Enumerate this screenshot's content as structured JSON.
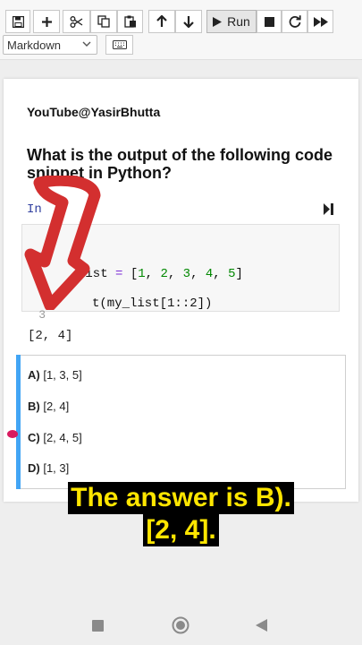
{
  "toolbar": {
    "buttons": [
      {
        "icon": "save-icon"
      },
      {
        "icon": "plus-icon"
      },
      {
        "icon": "scissors-icon"
      },
      {
        "icon": "copy-icon"
      },
      {
        "icon": "paste-icon"
      },
      {
        "icon": "arrow-up-icon"
      },
      {
        "icon": "arrow-down-icon"
      },
      {
        "icon": "play-icon"
      },
      {
        "icon": "stop-icon"
      },
      {
        "icon": "restart-icon"
      },
      {
        "icon": "fast-forward-icon"
      }
    ],
    "run_label": "Run",
    "cell_type": "Markdown",
    "keyboard_icon": "keyboard-icon"
  },
  "notebook": {
    "channel": "YouTube@YasirBhutta",
    "question": "What is the output of the following code snippet in Python?",
    "in_prompt": "In",
    "code_lines": [
      {
        "number": "1",
        "text_visible": "list = [1, 2, 3, 4, 5]"
      },
      {
        "number": "2",
        "text_visible": "t(my_list[1::2])"
      },
      {
        "number": "3",
        "text_visible": ""
      }
    ],
    "output": "[2, 4]",
    "options": [
      {
        "letter": "A)",
        "text": "[1, 3, 5]"
      },
      {
        "letter": "B)",
        "text": "[2, 4]"
      },
      {
        "letter": "C)",
        "text": "[2, 4, 5]"
      },
      {
        "letter": "D)",
        "text": "[1, 3]"
      }
    ]
  },
  "caption": {
    "line1": "The answer is B).",
    "line2": "[2, 4]."
  },
  "colors": {
    "caption_text": "#ffe600",
    "caption_bg": "#000000",
    "arrow": "#d32f2f",
    "cell_bar": "#42a5f5"
  }
}
